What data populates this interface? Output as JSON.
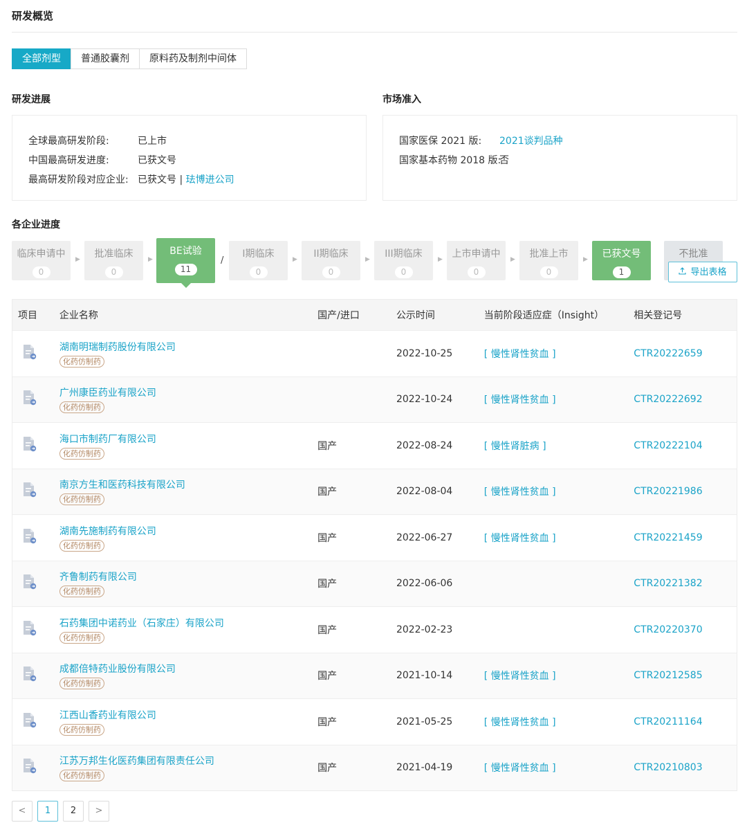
{
  "page_title": "研发概览",
  "tabs": [
    {
      "label": "全部剂型",
      "active": true
    },
    {
      "label": "普通胶囊剂",
      "active": false
    },
    {
      "label": "原料药及制剂中间体",
      "active": false
    }
  ],
  "rd_progress": {
    "title": "研发进展",
    "rows": [
      {
        "label": "全球最高研发阶段:",
        "value": "已上市"
      },
      {
        "label": "中国最高研发进度:",
        "value": "已获文号"
      },
      {
        "label": "最高研发阶段对应企业:",
        "value": "已获文号 | ",
        "link": "珐博进公司"
      }
    ]
  },
  "market_access": {
    "title": "市场准入",
    "rows": [
      {
        "label": "国家医保 2021 版:",
        "link": "2021谈判品种"
      },
      {
        "label": "国家基本药物 2018 版:",
        "value": "否"
      }
    ]
  },
  "enterprise_progress": {
    "title": "各企业进度",
    "stages": [
      {
        "label": "临床申请中",
        "count": "0"
      },
      {
        "label": "批准临床",
        "count": "0"
      },
      {
        "label": "BE试验",
        "count": "11"
      },
      {
        "label": "I期临床",
        "count": "0"
      },
      {
        "label": "II期临床",
        "count": "0"
      },
      {
        "label": "III期临床",
        "count": "0"
      },
      {
        "label": "上市申请中",
        "count": "0"
      },
      {
        "label": "批准上市",
        "count": "0"
      },
      {
        "label": "已获文号",
        "count": "1"
      },
      {
        "label": "不批准"
      }
    ],
    "slash": "/",
    "export_label": "导出表格"
  },
  "table": {
    "headers": [
      "项目",
      "企业名称",
      "国产/进口",
      "公示时间",
      "当前阶段适应症（Insight）",
      "相关登记号"
    ],
    "tag_label": "化药仿制药",
    "rows": [
      {
        "company": "湖南明瑞制药股份有限公司",
        "origin": "",
        "date": "2022-10-25",
        "indication": "[ 慢性肾性贫血 ]",
        "regno": "CTR20222659"
      },
      {
        "company": "广州康臣药业有限公司",
        "origin": "",
        "date": "2022-10-24",
        "indication": "[ 慢性肾性贫血 ]",
        "regno": "CTR20222692"
      },
      {
        "company": "海口市制药厂有限公司",
        "origin": "国产",
        "date": "2022-08-24",
        "indication": "[ 慢性肾脏病 ]",
        "regno": "CTR20222104"
      },
      {
        "company": "南京方生和医药科技有限公司",
        "origin": "国产",
        "date": "2022-08-04",
        "indication": "[ 慢性肾性贫血 ]",
        "regno": "CTR20221986"
      },
      {
        "company": "湖南先施制药有限公司",
        "origin": "国产",
        "date": "2022-06-27",
        "indication": "[ 慢性肾性贫血 ]",
        "regno": "CTR20221459"
      },
      {
        "company": "齐鲁制药有限公司",
        "origin": "国产",
        "date": "2022-06-06",
        "indication": "",
        "regno": "CTR20221382"
      },
      {
        "company": "石药集团中诺药业（石家庄）有限公司",
        "origin": "国产",
        "date": "2022-02-23",
        "indication": "",
        "regno": "CTR20220370"
      },
      {
        "company": "成都倍特药业股份有限公司",
        "origin": "国产",
        "date": "2021-10-14",
        "indication": "[ 慢性肾性贫血 ]",
        "regno": "CTR20212585"
      },
      {
        "company": "江西山香药业有限公司",
        "origin": "国产",
        "date": "2021-05-25",
        "indication": "[ 慢性肾性贫血 ]",
        "regno": "CTR20211164"
      },
      {
        "company": "江苏万邦生化医药集团有限责任公司",
        "origin": "国产",
        "date": "2021-04-19",
        "indication": "[ 慢性肾性贫血 ]",
        "regno": "CTR20210803"
      }
    ]
  },
  "pagination": {
    "prev": "<",
    "pages": [
      "1",
      "2"
    ],
    "current": "1",
    "next": ">"
  },
  "colors": {
    "accent": "#17a9c7",
    "link": "#1aa3c8",
    "stage_active": "#73bd78"
  }
}
